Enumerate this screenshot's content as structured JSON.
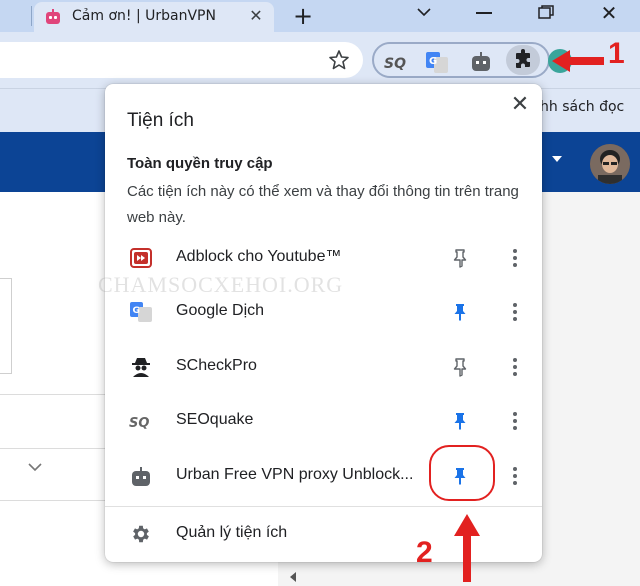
{
  "browser": {
    "tab": {
      "title": "Cảm ơn! | UrbanVPN"
    },
    "bookmarks_bar": {
      "partial_text": "hh sách đọc"
    }
  },
  "popup": {
    "title": "Tiện ích",
    "section_title": "Toàn quyền truy cập",
    "section_description": "Các tiện ích này có thể xem và thay đổi thông tin trên trang web này.",
    "extensions": [
      {
        "name": "Adblock cho Youtube™",
        "icon": "adblock-icon",
        "pinned": false
      },
      {
        "name": "Google Dịch",
        "icon": "google-translate-icon",
        "pinned": true
      },
      {
        "name": "SCheckPro",
        "icon": "spy-icon",
        "pinned": false
      },
      {
        "name": "SEOquake",
        "icon": "seoquake-icon",
        "pinned": true
      },
      {
        "name": "Urban Free VPN proxy Unblock...",
        "icon": "robot-icon",
        "pinned": true
      }
    ],
    "manage_label": "Quản lý tiện ích"
  },
  "annotations": {
    "step_1": "1",
    "step_2": "2",
    "color": "#e22120"
  },
  "watermark": "CHAMSOCXEHOI.ORG",
  "colors": {
    "tabstrip": "#c5d7f2",
    "toolbar": "#dee7f6",
    "page_header": "#0c4495",
    "pin_active": "#1a73e8",
    "pin_inactive": "#5f6368"
  }
}
